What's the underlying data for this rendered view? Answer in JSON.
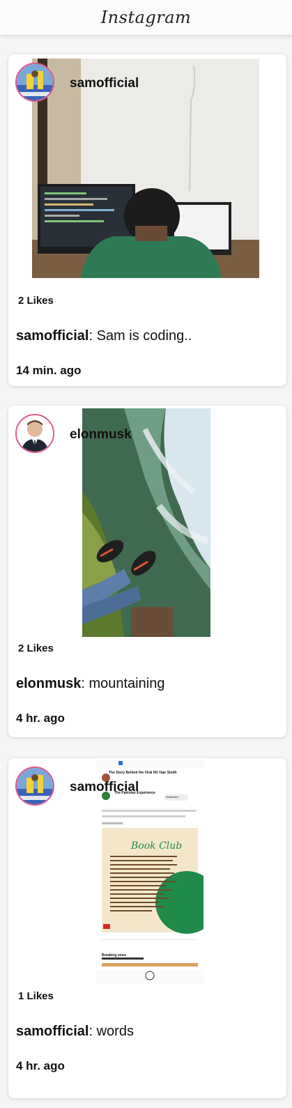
{
  "app": {
    "logo": "Instagram"
  },
  "posts": [
    {
      "username": "samofficial",
      "likes": "2 Likes",
      "caption_user": "samofficial",
      "caption_text": ": Sam is coding..",
      "time": "14 min. ago"
    },
    {
      "username": "elonmusk",
      "likes": "2 Likes",
      "caption_user": "elonmusk",
      "caption_text": ": mountaining",
      "time": "4 hr. ago"
    },
    {
      "username": "samofficial",
      "likes": "1 Likes",
      "caption_user": "samofficial",
      "caption_text": ": words",
      "time": "4 hr. ago"
    }
  ],
  "post3_screenshot": {
    "video_title": "The Story Behind the Viral Hit Yaar Sindh",
    "channel": "The Pakistan Experience",
    "subscribe": "Subscribe",
    "post_text": "People keep asking me what book they should read to know more about the History",
    "read_more": "READ MORE",
    "book_club": "Book Club",
    "breaking": "Breaking news"
  }
}
